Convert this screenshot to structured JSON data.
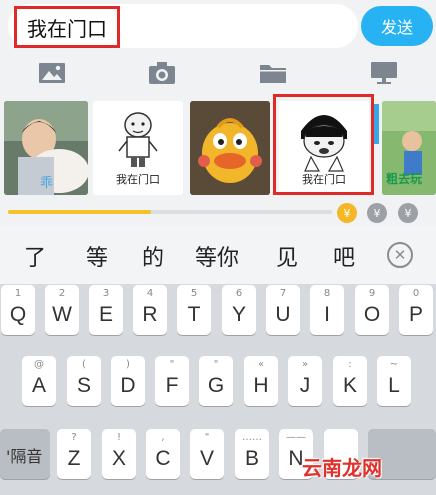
{
  "compose": {
    "message_text": "我在门口",
    "send_label": "发送"
  },
  "toolbar": {
    "items": [
      "image-icon",
      "camera-icon",
      "folder-icon",
      "monitor-icon"
    ]
  },
  "stickers": {
    "items": [
      {
        "type": "photo-child",
        "caption": ""
      },
      {
        "type": "cartoon-bald-man",
        "caption": "我在门口"
      },
      {
        "type": "photo-duck-toy",
        "caption": ""
      },
      {
        "type": "cartoon-bowl-cut-man",
        "caption": "我在门口",
        "selected": true
      },
      {
        "type": "photo-outdoor",
        "caption": "粗去玩"
      }
    ]
  },
  "sticker_progress": {
    "fraction": 0.44
  },
  "coins": [
    {
      "color": "#f4b728",
      "symbol": "¥",
      "active": true
    },
    {
      "color": "#9da0a5",
      "symbol": "¥",
      "active": false
    },
    {
      "color": "#9da0a5",
      "symbol": "¥",
      "active": false
    }
  ],
  "candidates": [
    "了",
    "等",
    "的",
    "等你",
    "见",
    "吧"
  ],
  "keyboard": {
    "row1": [
      {
        "hint": "1",
        "key": "Q"
      },
      {
        "hint": "2",
        "key": "W"
      },
      {
        "hint": "3",
        "key": "E"
      },
      {
        "hint": "4",
        "key": "R"
      },
      {
        "hint": "5",
        "key": "T"
      },
      {
        "hint": "6",
        "key": "Y"
      },
      {
        "hint": "7",
        "key": "U"
      },
      {
        "hint": "8",
        "key": "I"
      },
      {
        "hint": "9",
        "key": "O"
      },
      {
        "hint": "0",
        "key": "P"
      }
    ],
    "row2": [
      {
        "hint": "@",
        "key": "A"
      },
      {
        "hint": "(",
        "key": "S"
      },
      {
        "hint": ")",
        "key": "D"
      },
      {
        "hint": "\"",
        "key": "F"
      },
      {
        "hint": "\"",
        "key": "G"
      },
      {
        "hint": "«",
        "key": "H"
      },
      {
        "hint": "»",
        "key": "J"
      },
      {
        "hint": ":",
        "key": "K"
      },
      {
        "hint": "~",
        "key": "L"
      }
    ],
    "row3": [
      {
        "hint": "?",
        "key": "Z"
      },
      {
        "hint": "!",
        "key": "X"
      },
      {
        "hint": ",",
        "key": "C"
      },
      {
        "hint": "\"",
        "key": "V"
      },
      {
        "hint": "……",
        "key": "B"
      },
      {
        "hint": "——",
        "key": "N"
      }
    ],
    "separator_label": "'隔音"
  },
  "watermark": "云南龙网"
}
